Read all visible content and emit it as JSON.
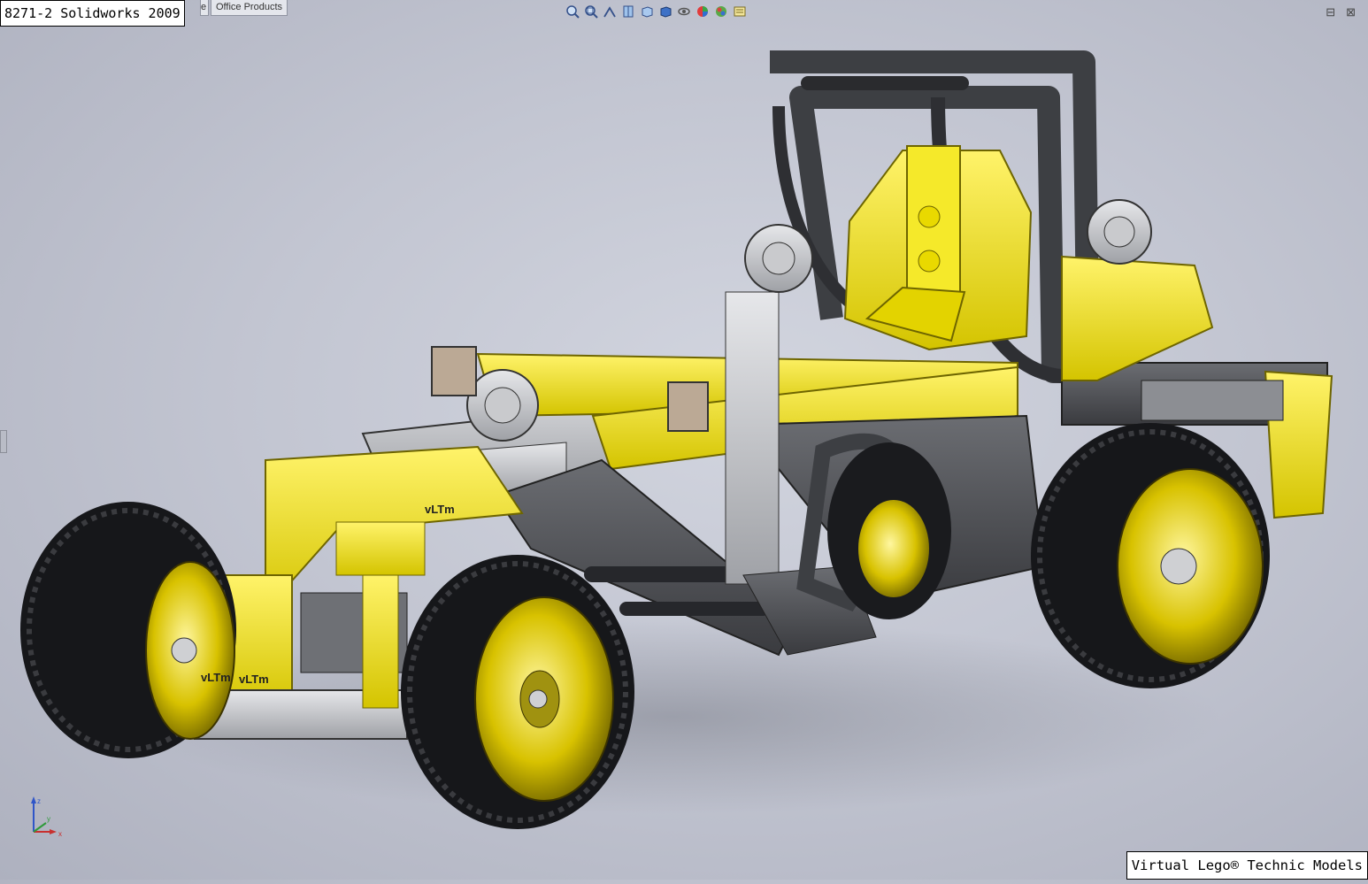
{
  "window": {
    "title": "8271-2 Solidworks 2009"
  },
  "tabs": [
    {
      "label": "e"
    },
    {
      "label": "Office Products"
    }
  ],
  "view_toolbar": {
    "icons": [
      "zoom-to-fit-icon",
      "zoom-area-icon",
      "previous-view-icon",
      "section-view-icon",
      "view-orientation-icon",
      "display-style-icon",
      "hide-show-icon",
      "edit-appearance-icon",
      "apply-scene-icon",
      "view-settings-icon"
    ]
  },
  "window_controls": {
    "restore": "⊟",
    "close": "⊠"
  },
  "watermark": {
    "text": "vLTm"
  },
  "triad": {
    "axes": [
      "x",
      "y",
      "z"
    ]
  },
  "footer": {
    "text": "Virtual Lego® Technic Models"
  },
  "colors": {
    "yellow": "#f2e300",
    "dark_gray": "#505257",
    "light_gray": "#d9dadd",
    "tire": "#16171a",
    "background": "#c3c6d2"
  }
}
